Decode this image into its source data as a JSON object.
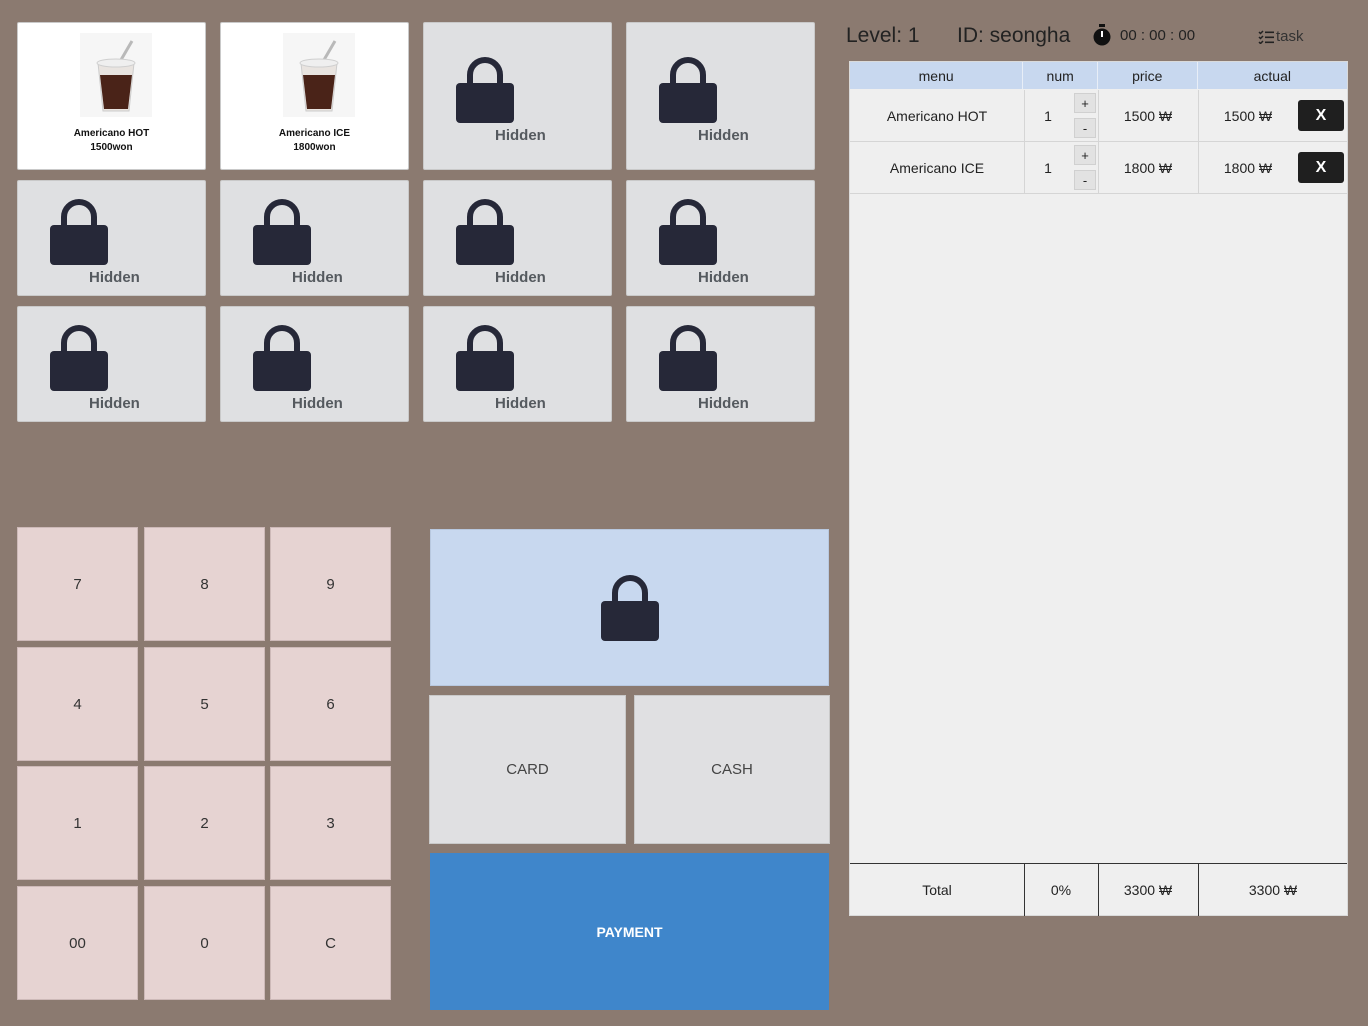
{
  "products": [
    {
      "name": "Americano HOT",
      "price": "1500won"
    },
    {
      "name": "Americano ICE",
      "price": "1800won"
    }
  ],
  "hidden_label": "Hidden",
  "keypad": [
    "7",
    "8",
    "9",
    "4",
    "5",
    "6",
    "1",
    "2",
    "3",
    "00",
    "0",
    "C"
  ],
  "payment": {
    "card": "CARD",
    "cash": "CASH",
    "pay": "PAYMENT"
  },
  "header": {
    "level": "Level: 1",
    "id": "ID: seongha",
    "timer": "00 : 00 : 00",
    "task": "task"
  },
  "table": {
    "columns": [
      "menu",
      "num",
      "price",
      "actual"
    ],
    "rows": [
      {
        "menu": "Americano HOT",
        "num": "1",
        "price": "1500 ₩",
        "actual": "1500 ₩"
      },
      {
        "menu": "Americano ICE",
        "num": "1",
        "price": "1800 ₩",
        "actual": "1800 ₩"
      }
    ],
    "plus": "+",
    "minus": "-",
    "remove": "X",
    "total": {
      "label": "Total",
      "discount": "0%",
      "price": "3300 ₩",
      "actual": "3300 ₩"
    }
  },
  "icons": {
    "lock": "lock-icon",
    "timer": "stopwatch-icon",
    "task": "checklist-icon",
    "cup": "iced-coffee-icon"
  },
  "colors": {
    "background": "#8b7a70",
    "payment": "#3f86cb",
    "header": "#c8d8ef",
    "keypad": "#e6d3d2",
    "lock": "#262838"
  }
}
